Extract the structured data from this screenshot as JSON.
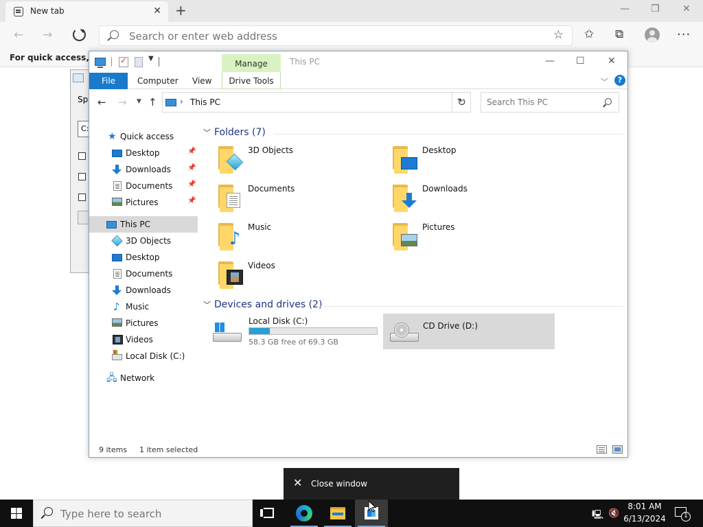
{
  "browser": {
    "tab_title": "New tab",
    "address_placeholder": "Search or enter web address",
    "favorites_bar_text": "For quick access, plac"
  },
  "background_dialog": {
    "label": "Spe",
    "field_value": "C:"
  },
  "explorer": {
    "window_title": "This PC",
    "manage_tab": "Manage",
    "ribbon_tabs": {
      "file": "File",
      "computer": "Computer",
      "view": "View",
      "drive_tools": "Drive Tools"
    },
    "address_path": "This PC",
    "search_placeholder": "Search This PC",
    "nav": {
      "quick_access": "Quick access",
      "qa_desktop": "Desktop",
      "qa_downloads": "Downloads",
      "qa_documents": "Documents",
      "qa_pictures": "Pictures",
      "this_pc": "This PC",
      "pc_3d": "3D Objects",
      "pc_desktop": "Desktop",
      "pc_documents": "Documents",
      "pc_downloads": "Downloads",
      "pc_music": "Music",
      "pc_pictures": "Pictures",
      "pc_videos": "Videos",
      "pc_localdisk": "Local Disk (C:)",
      "network": "Network"
    },
    "folders_header": "Folders (7)",
    "folders": {
      "f3d": "3D Objects",
      "desktop": "Desktop",
      "documents": "Documents",
      "downloads": "Downloads",
      "music": "Music",
      "pictures": "Pictures",
      "videos": "Videos"
    },
    "devices_header": "Devices and drives (2)",
    "drives": {
      "c_name": "Local Disk (C:)",
      "c_free": "58.3 GB free of 69.3 GB",
      "c_used_fraction": 0.16,
      "d_name": "CD Drive (D:)"
    },
    "status": {
      "items": "9 items",
      "selected": "1 item selected"
    }
  },
  "tooltip": {
    "text": "Close window"
  },
  "taskbar": {
    "search_placeholder": "Type here to search",
    "time": "8:01 AM",
    "date": "6/13/2024",
    "notification_count": "1"
  },
  "icons": {
    "accent": "#1979ca",
    "manage_tab_bg": "#d9f2c1",
    "selection_bg": "#d9d9d9",
    "group_header_color": "#1e3287"
  }
}
